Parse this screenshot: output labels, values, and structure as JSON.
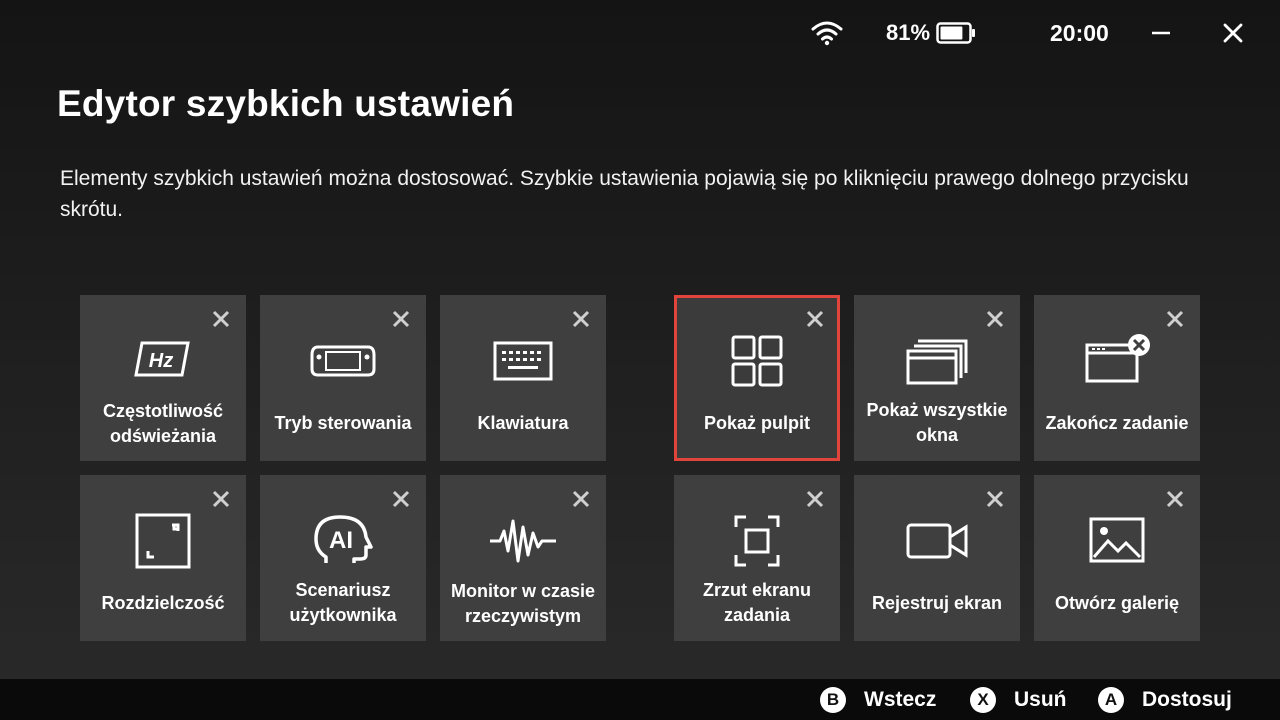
{
  "status": {
    "battery_percent": "81%",
    "battery_level": 0.81,
    "time": "20:00",
    "wifi_icon": "wifi-icon",
    "battery_icon": "battery-icon"
  },
  "header": {
    "title": "Edytor szybkich ustawień",
    "description": "Elementy szybkich ustawień można dostosować. Szybkie ustawienia pojawią się po kliknięciu prawego dolnego przycisku skrótu."
  },
  "colors": {
    "selected_border": "#e0443a",
    "tile_background": "#3f3f3f"
  },
  "tiles": [
    {
      "label": "Częstotliwość odświeżania",
      "icon": "refresh-rate-icon",
      "selected": false
    },
    {
      "label": "Tryb sterowania",
      "icon": "handheld-device-icon",
      "selected": false
    },
    {
      "label": "Klawiatura",
      "icon": "keyboard-icon",
      "selected": false
    },
    {
      "label": "Pokaż pulpit",
      "icon": "grid-icon",
      "selected": true
    },
    {
      "label": "Pokaż wszystkie okna",
      "icon": "windows-stack-icon",
      "selected": false
    },
    {
      "label": "Zakończ zadanie",
      "icon": "close-window-icon",
      "selected": false
    },
    {
      "label": "Rozdzielczość",
      "icon": "resolution-icon",
      "selected": false
    },
    {
      "label": "Scenariusz użytkownika",
      "icon": "ai-head-icon",
      "selected": false
    },
    {
      "label": "Monitor w czasie rzeczywistym",
      "icon": "waveform-icon",
      "selected": false
    },
    {
      "label": "Zrzut ekranu zadania",
      "icon": "screenshot-icon",
      "selected": false
    },
    {
      "label": "Rejestruj ekran",
      "icon": "video-camera-icon",
      "selected": false
    },
    {
      "label": "Otwórz galerię",
      "icon": "image-icon",
      "selected": false
    }
  ],
  "footer": {
    "back": {
      "button": "B",
      "label": "Wstecz"
    },
    "remove": {
      "button": "X",
      "label": "Usuń"
    },
    "customize": {
      "button": "A",
      "label": "Dostosuj"
    }
  }
}
